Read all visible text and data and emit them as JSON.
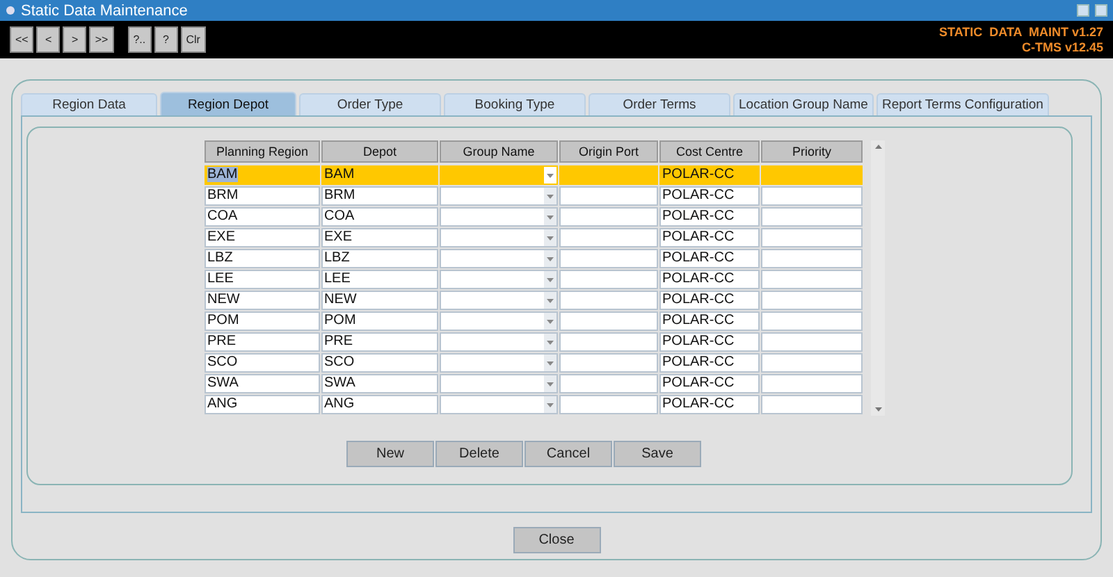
{
  "window": {
    "title": "Static Data Maintenance"
  },
  "toolbar": {
    "buttons": [
      "<<",
      "<",
      ">",
      ">>",
      "?..",
      "?",
      "Clr"
    ],
    "app_name": "STATIC  DATA  MAINT v1.27",
    "version": "C-TMS v12.45"
  },
  "tabs": [
    {
      "label": "Region Data",
      "selected": false
    },
    {
      "label": "Region Depot",
      "selected": true
    },
    {
      "label": "Order Type",
      "selected": false
    },
    {
      "label": "Booking Type",
      "selected": false
    },
    {
      "label": "Order Terms",
      "selected": false
    },
    {
      "label": "Location Group Name",
      "selected": false
    },
    {
      "label": "Report Terms Configuration",
      "selected": false
    }
  ],
  "table": {
    "columns": [
      {
        "label": "Planning Region",
        "kind": "text"
      },
      {
        "label": "Depot",
        "kind": "text"
      },
      {
        "label": "Group Name",
        "kind": "dropdown"
      },
      {
        "label": "Origin Port",
        "kind": "text"
      },
      {
        "label": "Cost Centre",
        "kind": "text"
      },
      {
        "label": "Priority",
        "kind": "text"
      }
    ],
    "rows": [
      {
        "planning_region": "BAM",
        "depot": "BAM",
        "cost_centre": "POLAR-CC",
        "selected": true
      },
      {
        "planning_region": "BRM",
        "depot": "BRM",
        "cost_centre": "POLAR-CC",
        "selected": false
      },
      {
        "planning_region": "COA",
        "depot": "COA",
        "cost_centre": "POLAR-CC",
        "selected": false
      },
      {
        "planning_region": "EXE",
        "depot": "EXE",
        "cost_centre": "POLAR-CC",
        "selected": false
      },
      {
        "planning_region": "LBZ",
        "depot": "LBZ",
        "cost_centre": "POLAR-CC",
        "selected": false
      },
      {
        "planning_region": "LEE",
        "depot": "LEE",
        "cost_centre": "POLAR-CC",
        "selected": false
      },
      {
        "planning_region": "NEW",
        "depot": "NEW",
        "cost_centre": "POLAR-CC",
        "selected": false
      },
      {
        "planning_region": "POM",
        "depot": "POM",
        "cost_centre": "POLAR-CC",
        "selected": false
      },
      {
        "planning_region": "PRE",
        "depot": "PRE",
        "cost_centre": "POLAR-CC",
        "selected": false
      },
      {
        "planning_region": "SCO",
        "depot": "SCO",
        "cost_centre": "POLAR-CC",
        "selected": false
      },
      {
        "planning_region": "SWA",
        "depot": "SWA",
        "cost_centre": "POLAR-CC",
        "selected": false
      },
      {
        "planning_region": "ANG",
        "depot": "ANG",
        "cost_centre": "POLAR-CC",
        "selected": false
      }
    ]
  },
  "actions": [
    "New",
    "Delete",
    "Cancel",
    "Save"
  ],
  "close_button": "Close"
}
